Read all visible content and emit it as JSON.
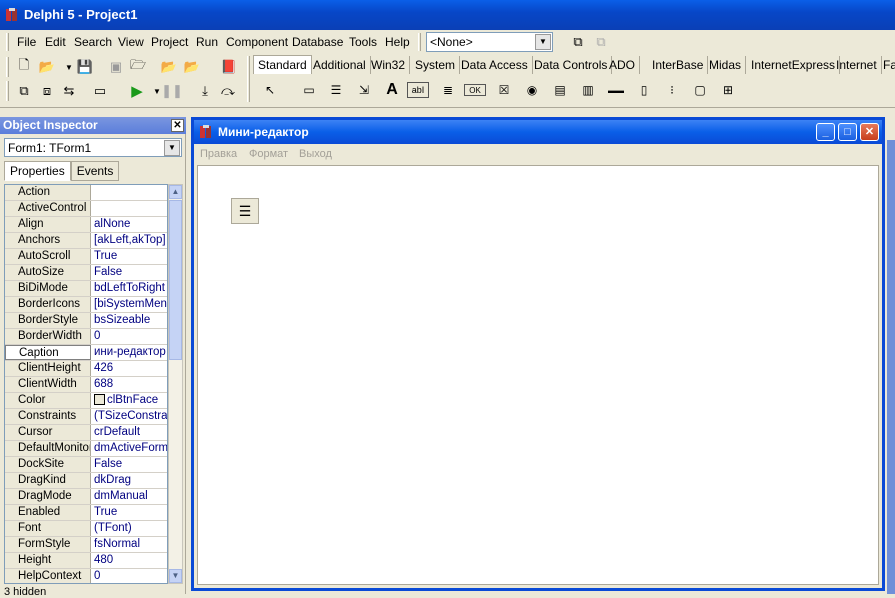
{
  "app_title": "Delphi 5 - Project1",
  "menu": [
    "File",
    "Edit",
    "Search",
    "View",
    "Project",
    "Run",
    "Component",
    "Database",
    "Tools",
    "Help"
  ],
  "desktop_combo": "<None>",
  "palette_tabs": [
    "Standard",
    "Additional",
    "Win32",
    "System",
    "Data Access",
    "Data Controls",
    "ADO",
    "InterBase",
    "Midas",
    "InternetExpress",
    "Internet",
    "Fa"
  ],
  "object_inspector": {
    "title": "Object Inspector",
    "selected_object": "Form1: TForm1",
    "tabs": [
      "Properties",
      "Events"
    ],
    "status": "3 hidden",
    "properties": [
      {
        "name": "Action",
        "value": ""
      },
      {
        "name": "ActiveControl",
        "value": ""
      },
      {
        "name": "Align",
        "value": "alNone"
      },
      {
        "name": "Anchors",
        "value": "[akLeft,akTop]",
        "expandable": true
      },
      {
        "name": "AutoScroll",
        "value": "True"
      },
      {
        "name": "AutoSize",
        "value": "False"
      },
      {
        "name": "BiDiMode",
        "value": "bdLeftToRight"
      },
      {
        "name": "BorderIcons",
        "value": "[biSystemMenu",
        "expandable": true
      },
      {
        "name": "BorderStyle",
        "value": "bsSizeable"
      },
      {
        "name": "BorderWidth",
        "value": "0"
      },
      {
        "name": "Caption",
        "value": "ини-редактор",
        "selected": true
      },
      {
        "name": "ClientHeight",
        "value": "426"
      },
      {
        "name": "ClientWidth",
        "value": "688"
      },
      {
        "name": "Color",
        "value": "clBtnFace",
        "swatch": true
      },
      {
        "name": "Constraints",
        "value": "(TSizeConstrair",
        "expandable": true
      },
      {
        "name": "Cursor",
        "value": "crDefault"
      },
      {
        "name": "DefaultMonitor",
        "value": "dmActiveForm"
      },
      {
        "name": "DockSite",
        "value": "False"
      },
      {
        "name": "DragKind",
        "value": "dkDrag"
      },
      {
        "name": "DragMode",
        "value": "dmManual"
      },
      {
        "name": "Enabled",
        "value": "True"
      },
      {
        "name": "Font",
        "value": "(TFont)",
        "expandable": true
      },
      {
        "name": "FormStyle",
        "value": "fsNormal"
      },
      {
        "name": "Height",
        "value": "480"
      },
      {
        "name": "HelpContext",
        "value": "0"
      }
    ]
  },
  "form": {
    "title": "Мини-редактор",
    "menu": [
      "Правка",
      "Формат",
      "Выход"
    ]
  }
}
